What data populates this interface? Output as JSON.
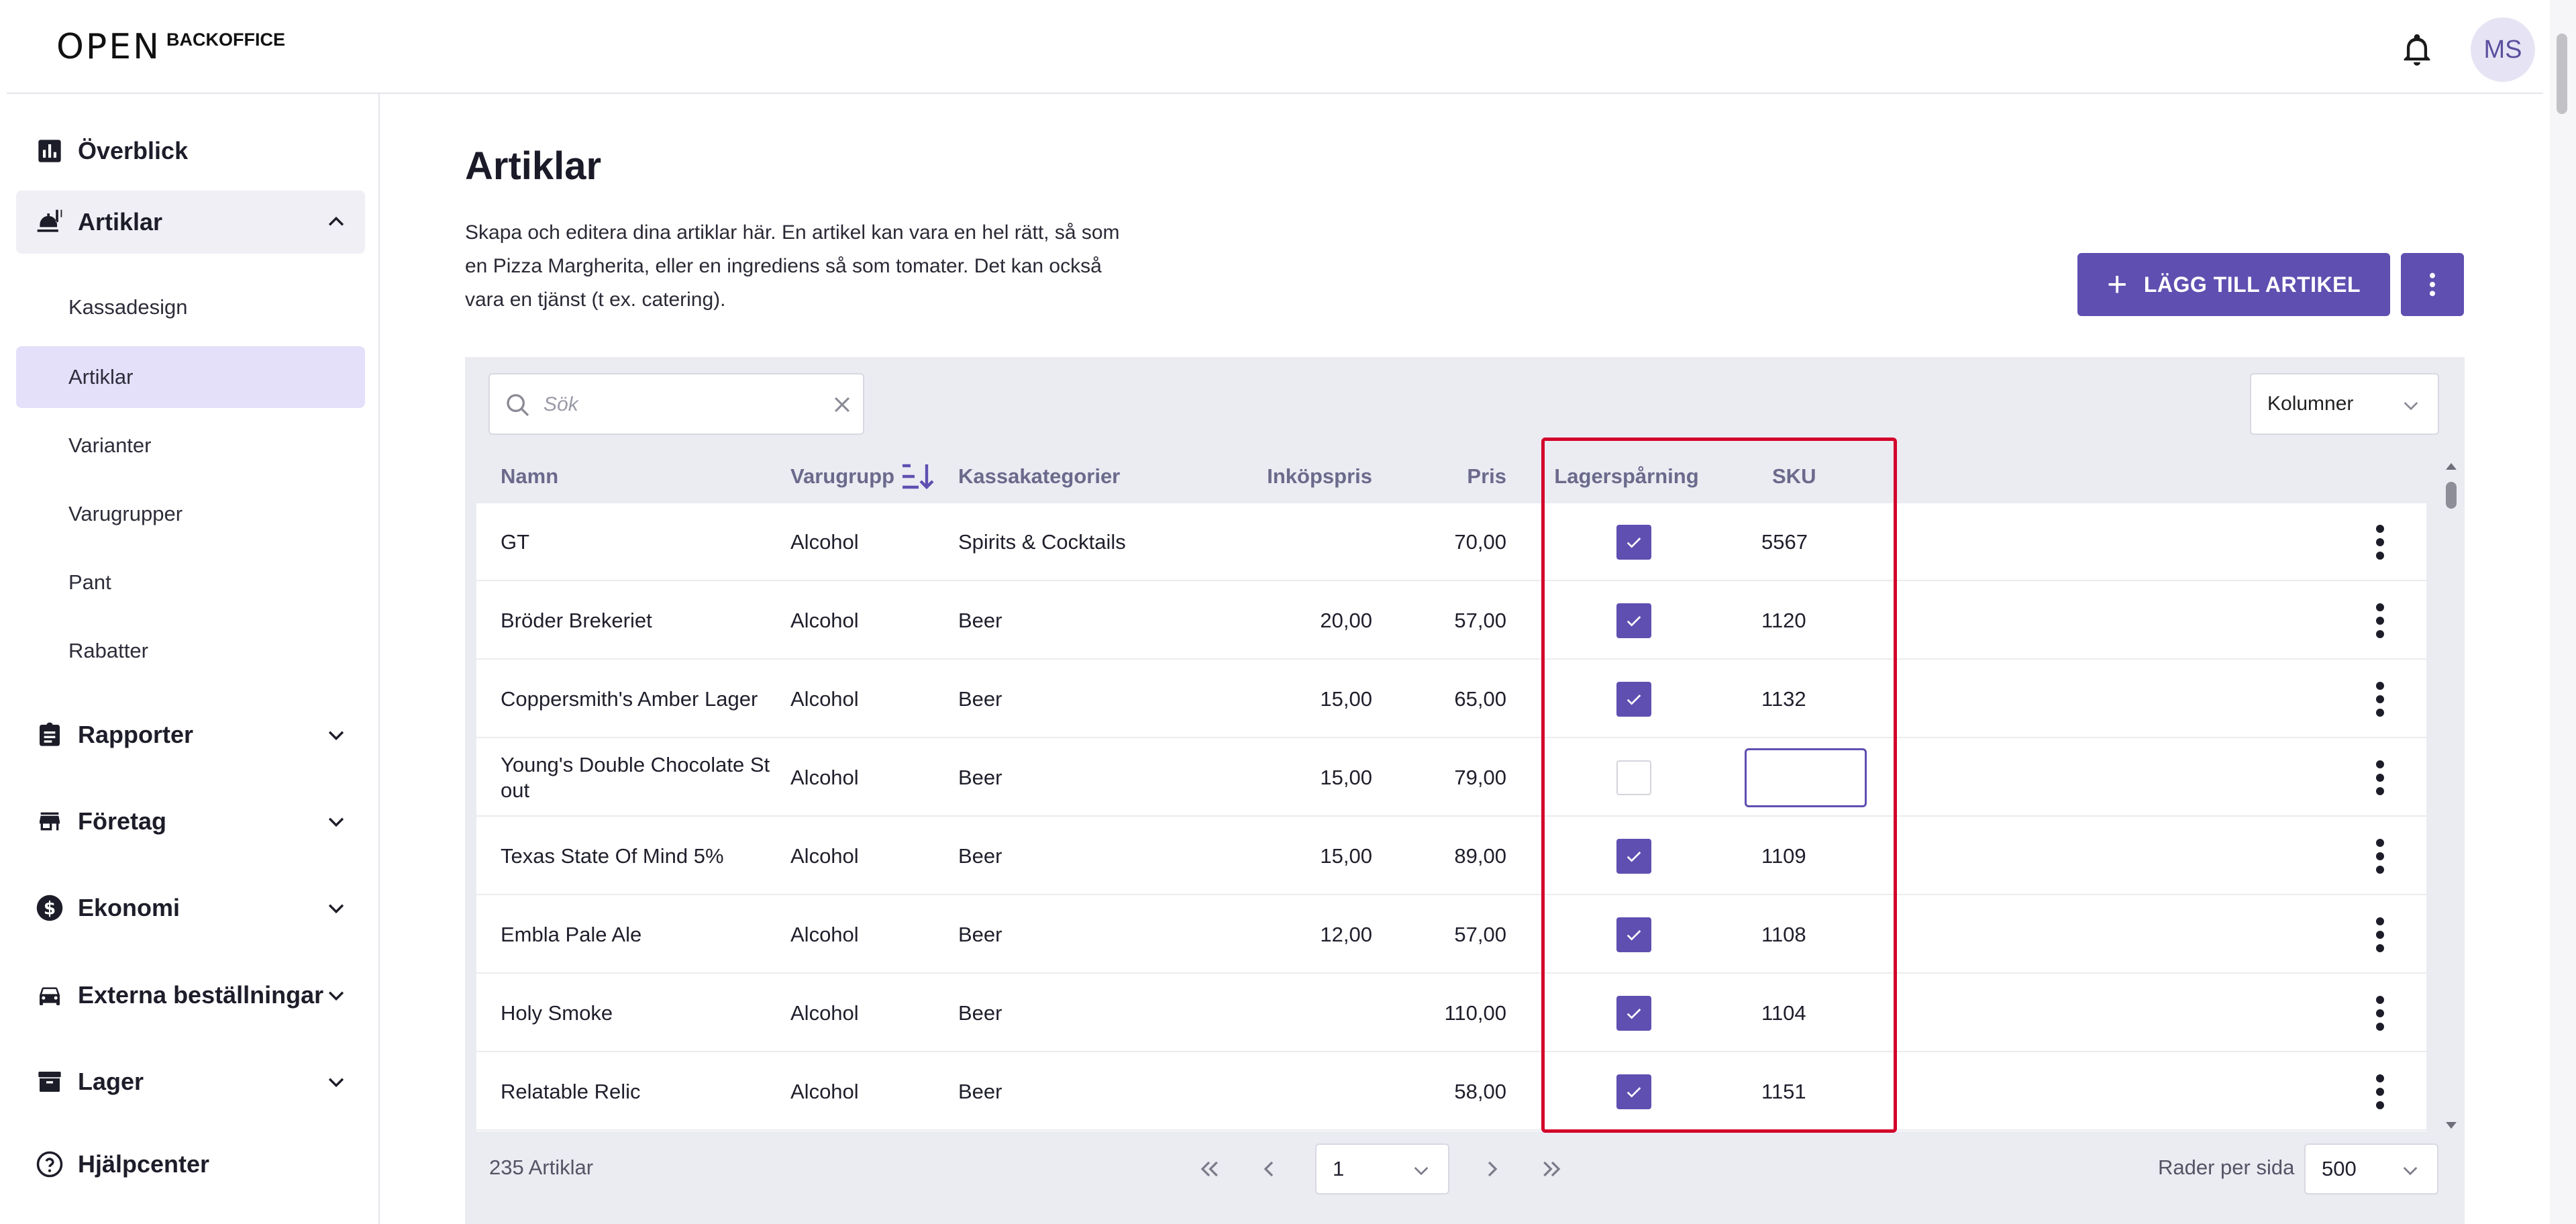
{
  "header": {
    "logo_text": "OPEN",
    "logo_suffix": "BACKOFFICE",
    "avatar_initials": "MS"
  },
  "sidebar": {
    "overview": "Överblick",
    "articles": "Artiklar",
    "sub_items": [
      "Kassadesign",
      "Artiklar",
      "Varianter",
      "Varugrupper",
      "Pant",
      "Rabatter"
    ],
    "reports": "Rapporter",
    "company": "Företag",
    "economy": "Ekonomi",
    "external_orders": "Externa beställningar",
    "stock": "Lager",
    "help": "Hjälpcenter"
  },
  "main": {
    "title": "Artiklar",
    "description": "Skapa och editera dina artiklar här. En artikel kan vara en hel rätt, så som en Pizza Margherita, eller en ingrediens så som tomater. Det kan också vara en tjänst (t ex. catering).",
    "add_button": "LÄGG TILL ARTIKEL"
  },
  "table": {
    "search_placeholder": "Sök",
    "columns_button": "Kolumner",
    "headers": {
      "name": "Namn",
      "group": "Varugrupp",
      "category": "Kassakategorier",
      "purchase_price": "Inköpspris",
      "price": "Pris",
      "tracking": "Lagerspårning",
      "sku": "SKU"
    },
    "rows": [
      {
        "name": "GT",
        "group": "Alcohol",
        "category": "Spirits & Cocktails",
        "purchase_price": "",
        "price": "70,00",
        "tracking": true,
        "sku": "5567"
      },
      {
        "name": "Bröder Brekeriet",
        "group": "Alcohol",
        "category": "Beer",
        "purchase_price": "20,00",
        "price": "57,00",
        "tracking": true,
        "sku": "1120"
      },
      {
        "name": "Coppersmith's Amber Lager",
        "group": "Alcohol",
        "category": "Beer",
        "purchase_price": "15,00",
        "price": "65,00",
        "tracking": true,
        "sku": "1132"
      },
      {
        "name": "Young's Double Chocolate St out",
        "group": "Alcohol",
        "category": "Beer",
        "purchase_price": "15,00",
        "price": "79,00",
        "tracking": false,
        "sku": ""
      },
      {
        "name": "Texas State Of Mind 5%",
        "group": "Alcohol",
        "category": "Beer",
        "purchase_price": "15,00",
        "price": "89,00",
        "tracking": true,
        "sku": "1109"
      },
      {
        "name": "Embla Pale Ale",
        "group": "Alcohol",
        "category": "Beer",
        "purchase_price": "12,00",
        "price": "57,00",
        "tracking": true,
        "sku": "1108"
      },
      {
        "name": "Holy Smoke",
        "group": "Alcohol",
        "category": "Beer",
        "purchase_price": "",
        "price": "110,00",
        "tracking": true,
        "sku": "1104"
      },
      {
        "name": "Relatable Relic",
        "group": "Alcohol",
        "category": "Beer",
        "purchase_price": "",
        "price": "58,00",
        "tracking": true,
        "sku": "1151"
      }
    ],
    "footer": {
      "count": "235 Artiklar",
      "page": "1",
      "rows_per_page_label": "Rader per sida",
      "rows_per_page": "500"
    }
  },
  "colors": {
    "accent": "#5f4fb1",
    "highlight_border": "#d3002a",
    "selected_nav": "#e4e0fa"
  }
}
